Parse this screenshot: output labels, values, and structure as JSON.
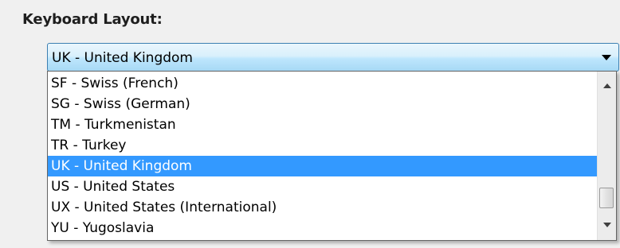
{
  "heading": "Keyboard Layout:",
  "combo": {
    "selected_value": "UK - United Kingdom"
  },
  "dropdown": {
    "options": [
      "SF - Swiss (French)",
      "SG - Swiss (German)",
      "TM - Turkmenistan",
      "TR - Turkey",
      "UK - United Kingdom",
      "US - United States",
      "UX - United States (International)",
      "YU - Yugoslavia"
    ],
    "selected_index": 4
  },
  "icons": {
    "combo_arrow": "chevron-down-icon",
    "scroll_up": "scroll-up-icon",
    "scroll_down": "scroll-down-icon"
  },
  "colors": {
    "selection": "#3399ff",
    "combo_border": "#3c7fb1"
  }
}
